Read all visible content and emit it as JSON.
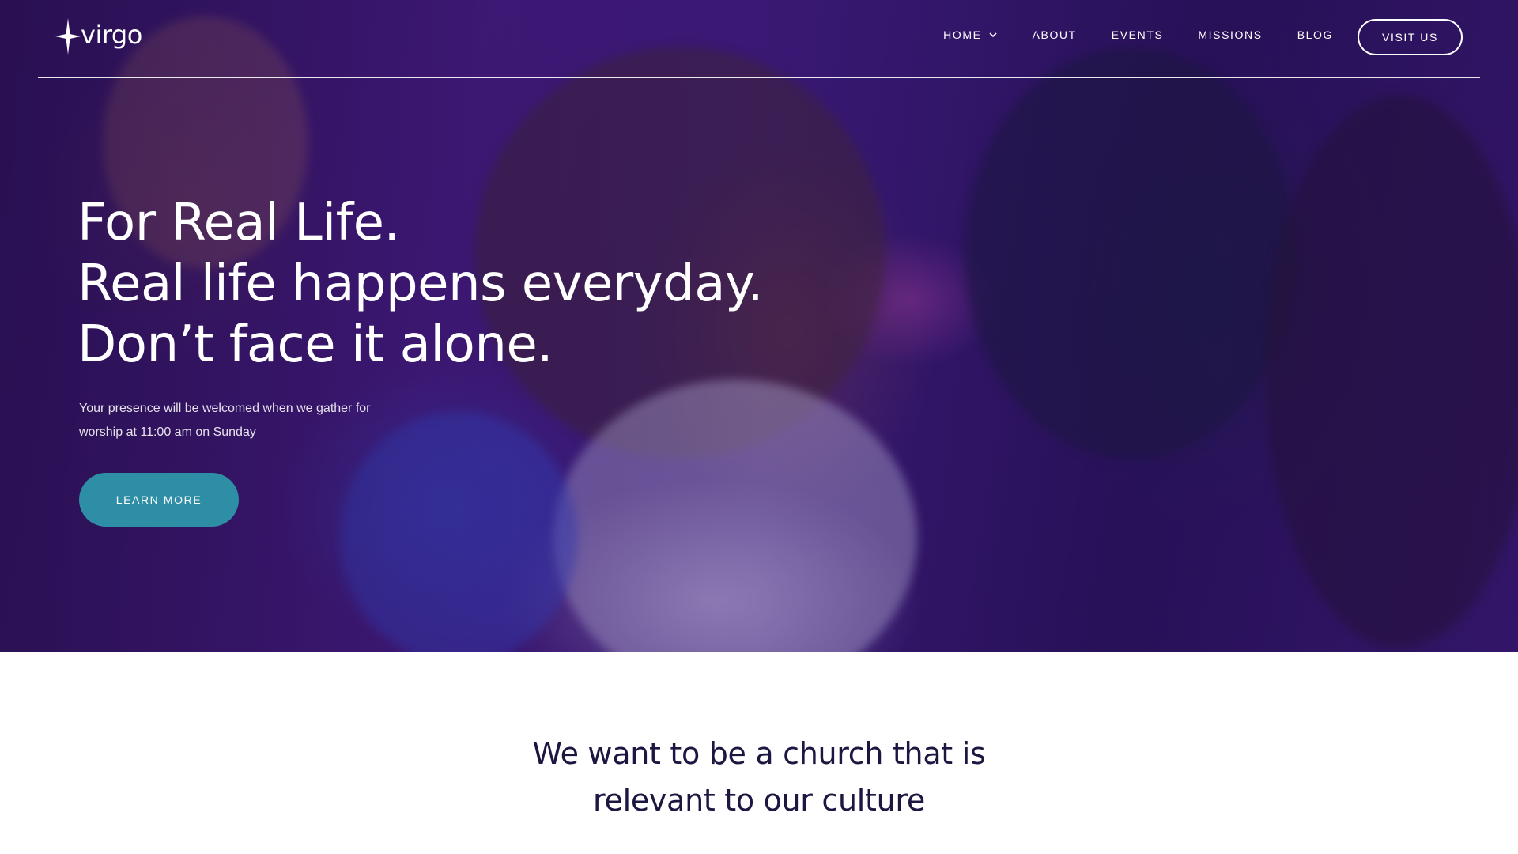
{
  "brand": {
    "name": "virgo",
    "logo_icon": "four-point-star-icon"
  },
  "nav": {
    "items": [
      {
        "label": "HOME",
        "has_dropdown": true
      },
      {
        "label": "ABOUT"
      },
      {
        "label": "EVENTS"
      },
      {
        "label": "MISSIONS"
      },
      {
        "label": "BLOG"
      }
    ],
    "cta_label": "VISIT US"
  },
  "hero": {
    "headline": [
      "For Real Life.",
      "Real life happens everyday.",
      "Don’t face it alone."
    ],
    "subtext": "Your presence will be welcomed when we gather for worship at 11:00 am on Sunday",
    "button_label": "LEARN MORE"
  },
  "mission": {
    "lines": [
      "We want to be a church that is",
      "relevant to our culture"
    ]
  },
  "colors": {
    "accent": "#2e8ea6",
    "heading_dark": "#1b1740",
    "hero_overlay": "#3a1670"
  }
}
